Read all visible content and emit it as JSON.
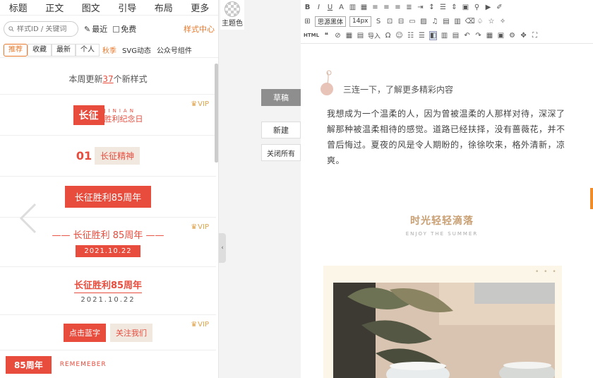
{
  "top_nav": [
    "标题",
    "正文",
    "图文",
    "引导",
    "布局",
    "更多"
  ],
  "search": {
    "placeholder": "样式ID / 关键词"
  },
  "filters": {
    "recent": "最近",
    "free": "免费",
    "center": "样式中心"
  },
  "tabs": [
    "推荐",
    "收藏",
    "最新",
    "个人"
  ],
  "tags": [
    "秋季",
    "SVG动态",
    "公众号组件"
  ],
  "update": {
    "prefix": "本周更新",
    "count": "37",
    "suffix": "个新样式"
  },
  "vip_label": "VIP",
  "styles": {
    "s1": {
      "box": "长征",
      "sub": "JINIAN",
      "txt": "胜利纪念日"
    },
    "s2": {
      "num": "01",
      "label": "长征精神"
    },
    "s3": {
      "label": "长征胜利85周年"
    },
    "s4": {
      "title": "—— 长征胜利 85周年 ——",
      "date": "2021.10.22"
    },
    "s5": {
      "title": "长征胜利85周年",
      "date": "2021.10.22"
    },
    "s6": {
      "a": "点击蓝字",
      "b": "关注我们"
    },
    "s7": {
      "a": "85周年",
      "b": "REMEMEBER"
    }
  },
  "middle": {
    "theme": "主题色",
    "draft": "草稿",
    "new": "新建",
    "close_all": "关闭所有"
  },
  "toolbar": {
    "font": "思源黑体",
    "size": "14px",
    "html": "HTML",
    "import": "导入"
  },
  "editor": {
    "heading": "三连一下，了解更多精彩内容",
    "paragraph": "我想成为一个温柔的人，因为曾被温柔的人那样对待，深深了解那种被温柔相待的感觉。道路已经扶择，没有蔷薇花，并不曾后悔过。夏夜的风是令人期盼的，徐徐吹来，格外清新，凉爽。",
    "section_title": "时光轻轻滴落",
    "section_sub": "ENJOY THE SUMMER",
    "dots": "• • •"
  },
  "colors": {
    "accent": "#e84c3d",
    "orange": "#e8792c",
    "gold": "#c9a073"
  }
}
